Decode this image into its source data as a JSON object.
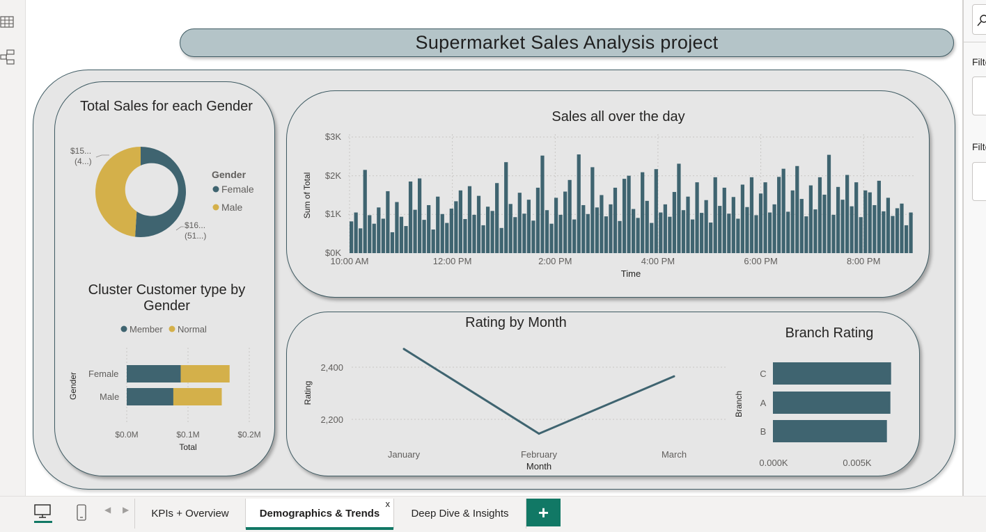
{
  "report_title": "Supermarket Sales Analysis project",
  "right_pane": {
    "filter_label_1": "Filte",
    "filter_label_2": "Filte"
  },
  "left_rail": {
    "icons": [
      "table-view-icon",
      "model-view-icon"
    ]
  },
  "gender_donut": {
    "title": "Total Sales for each Gender",
    "legend_title": "Gender",
    "slice_labels": [
      {
        "line1": "$15...",
        "line2": "(4...)"
      },
      {
        "line1": "$16...",
        "line2": "(51...)"
      }
    ],
    "colors": {
      "Female": "#3f6470",
      "Male": "#d4b04a"
    }
  },
  "cluster_chart": {
    "title_line1": "Cluster Customer type by",
    "title_line2": "Gender",
    "ylabel": "Gender",
    "xlabel": "Total",
    "ticks": [
      "$0.0M",
      "$0.1M",
      "$0.2M"
    ]
  },
  "day_chart": {
    "title": "Sales all over the day",
    "ylabel": "Sum of Total",
    "xlabel": "Time",
    "yticks": [
      "$0K",
      "$1K",
      "$2K",
      "$3K"
    ],
    "xticks": [
      "10:00 AM",
      "12:00 PM",
      "2:00 PM",
      "4:00 PM",
      "6:00 PM",
      "8:00 PM"
    ]
  },
  "month_chart": {
    "title": "Rating by Month",
    "ylabel": "Rating",
    "xlabel": "Month",
    "yticks": [
      "2,400",
      "2,200"
    ]
  },
  "branch_chart": {
    "title": "Branch Rating",
    "ylabel": "Branch",
    "xticks": [
      "0.000K",
      "0.005K"
    ]
  },
  "chart_data": [
    {
      "type": "pie",
      "title": "Total Sales for each Gender",
      "categories": [
        "Female",
        "Male"
      ],
      "values": [
        167883,
        155084
      ],
      "legend": "right"
    },
    {
      "type": "bar",
      "orientation": "horizontal",
      "stacked": true,
      "title": "Cluster Customer type by Gender",
      "categories": [
        "Female",
        "Male"
      ],
      "series": [
        {
          "name": "Member",
          "values": [
            88146,
            76076
          ],
          "color": "#3f6470"
        },
        {
          "name": "Normal",
          "values": [
            79737,
            79007
          ],
          "color": "#d4b04a"
        }
      ],
      "xlabel": "Total",
      "ylabel": "Gender",
      "xlim": [
        0,
        200000
      ],
      "legend": "top"
    },
    {
      "type": "bar",
      "title": "Sales all over the day",
      "xlabel": "Time",
      "ylabel": "Sum of Total",
      "xlim": [
        "10:00 AM",
        "9:00 PM"
      ],
      "ylim": [
        0,
        3000
      ],
      "grid": true,
      "color": "#3f6470",
      "x": [
        "10:00",
        "10:05",
        "10:10",
        "10:15",
        "10:20",
        "10:25",
        "10:30",
        "10:35",
        "10:40",
        "10:45",
        "10:50",
        "10:55",
        "11:00",
        "11:05",
        "11:10",
        "11:15",
        "11:20",
        "11:25",
        "11:30",
        "11:35",
        "11:40",
        "11:45",
        "11:50",
        "11:55",
        "12:00",
        "12:05",
        "12:10",
        "12:15",
        "12:20",
        "12:25",
        "12:30",
        "12:35",
        "12:40",
        "12:45",
        "12:50",
        "12:55",
        "13:00",
        "13:05",
        "13:10",
        "13:15",
        "13:20",
        "13:25",
        "13:30",
        "13:35",
        "13:40",
        "13:45",
        "13:50",
        "13:55",
        "14:00",
        "14:05",
        "14:10",
        "14:15",
        "14:20",
        "14:25",
        "14:30",
        "14:35",
        "14:40",
        "14:45",
        "14:50",
        "14:55",
        "15:00",
        "15:05",
        "15:10",
        "15:15",
        "15:20",
        "15:25",
        "15:30",
        "15:35",
        "15:40",
        "15:45",
        "15:50",
        "15:55",
        "16:00",
        "16:05",
        "16:10",
        "16:15",
        "16:20",
        "16:25",
        "16:30",
        "16:35",
        "16:40",
        "16:45",
        "16:50",
        "16:55",
        "17:00",
        "17:05",
        "17:10",
        "17:15",
        "17:20",
        "17:25",
        "17:30",
        "17:35",
        "17:40",
        "17:45",
        "17:50",
        "17:55",
        "18:00",
        "18:05",
        "18:10",
        "18:15",
        "18:20",
        "18:25",
        "18:30",
        "18:35",
        "18:40",
        "18:45",
        "18:50",
        "18:55",
        "19:00",
        "19:05",
        "19:10",
        "19:15",
        "19:20",
        "19:25",
        "19:30",
        "19:35",
        "19:40",
        "19:45",
        "19:50",
        "19:55",
        "20:00",
        "20:05",
        "20:10",
        "20:15",
        "20:20",
        "20:25",
        "20:30",
        "20:35",
        "20:40",
        "20:45",
        "20:50",
        "20:55"
      ],
      "values": [
        820,
        1050,
        640,
        2150,
        980,
        760,
        1180,
        890,
        1600,
        540,
        1320,
        940,
        700,
        1850,
        1120,
        1930,
        860,
        1240,
        610,
        1460,
        1010,
        780,
        1150,
        1340,
        1620,
        880,
        1730,
        990,
        1480,
        720,
        1200,
        1090,
        1810,
        650,
        2350,
        1270,
        930,
        1560,
        1020,
        1380,
        840,
        1690,
        2520,
        1110,
        760,
        1430,
        990,
        1590,
        1890,
        870,
        2550,
        1240,
        1010,
        2220,
        1180,
        1500,
        950,
        1260,
        1690,
        830,
        1920,
        2000,
        1140,
        910,
        2090,
        1350,
        780,
        2170,
        1050,
        1260,
        940,
        1580,
        2310,
        1110,
        1460,
        870,
        1830,
        1040,
        1370,
        790,
        1960,
        1220,
        1690,
        1020,
        1450,
        890,
        1770,
        1190,
        1960,
        980,
        1540,
        1830,
        1050,
        1260,
        1970,
        2180,
        1070,
        1620,
        2250,
        1400,
        950,
        1750,
        1130,
        1960,
        1510,
        2540,
        990,
        1710,
        1380,
        2020,
        1210,
        1830,
        930,
        1620,
        1570,
        1240,
        1870,
        1080,
        1430,
        960,
        1160,
        1280,
        720,
        1050
      ]
    },
    {
      "type": "line",
      "title": "Rating by Month",
      "categories": [
        "January",
        "February",
        "March"
      ],
      "values": [
        2470,
        2145,
        2365
      ],
      "xlabel": "Month",
      "ylabel": "Rating",
      "ylim": [
        2100,
        2500
      ],
      "color": "#3f6470"
    },
    {
      "type": "bar",
      "orientation": "horizontal",
      "title": "Branch Rating",
      "categories": [
        "C",
        "A",
        "B"
      ],
      "values": [
        7.07,
        7.03,
        6.82
      ],
      "ylabel": "Branch",
      "xlim": [
        0,
        8
      ],
      "color": "#3f6470"
    }
  ],
  "bottom_bar": {
    "tabs": [
      {
        "label": "KPIs + Overview",
        "active": false
      },
      {
        "label": "Demographics & Trends",
        "active": true
      },
      {
        "label": "Deep Dive & Insights",
        "active": false
      }
    ],
    "close_glyph": "x",
    "add_glyph": "+"
  }
}
